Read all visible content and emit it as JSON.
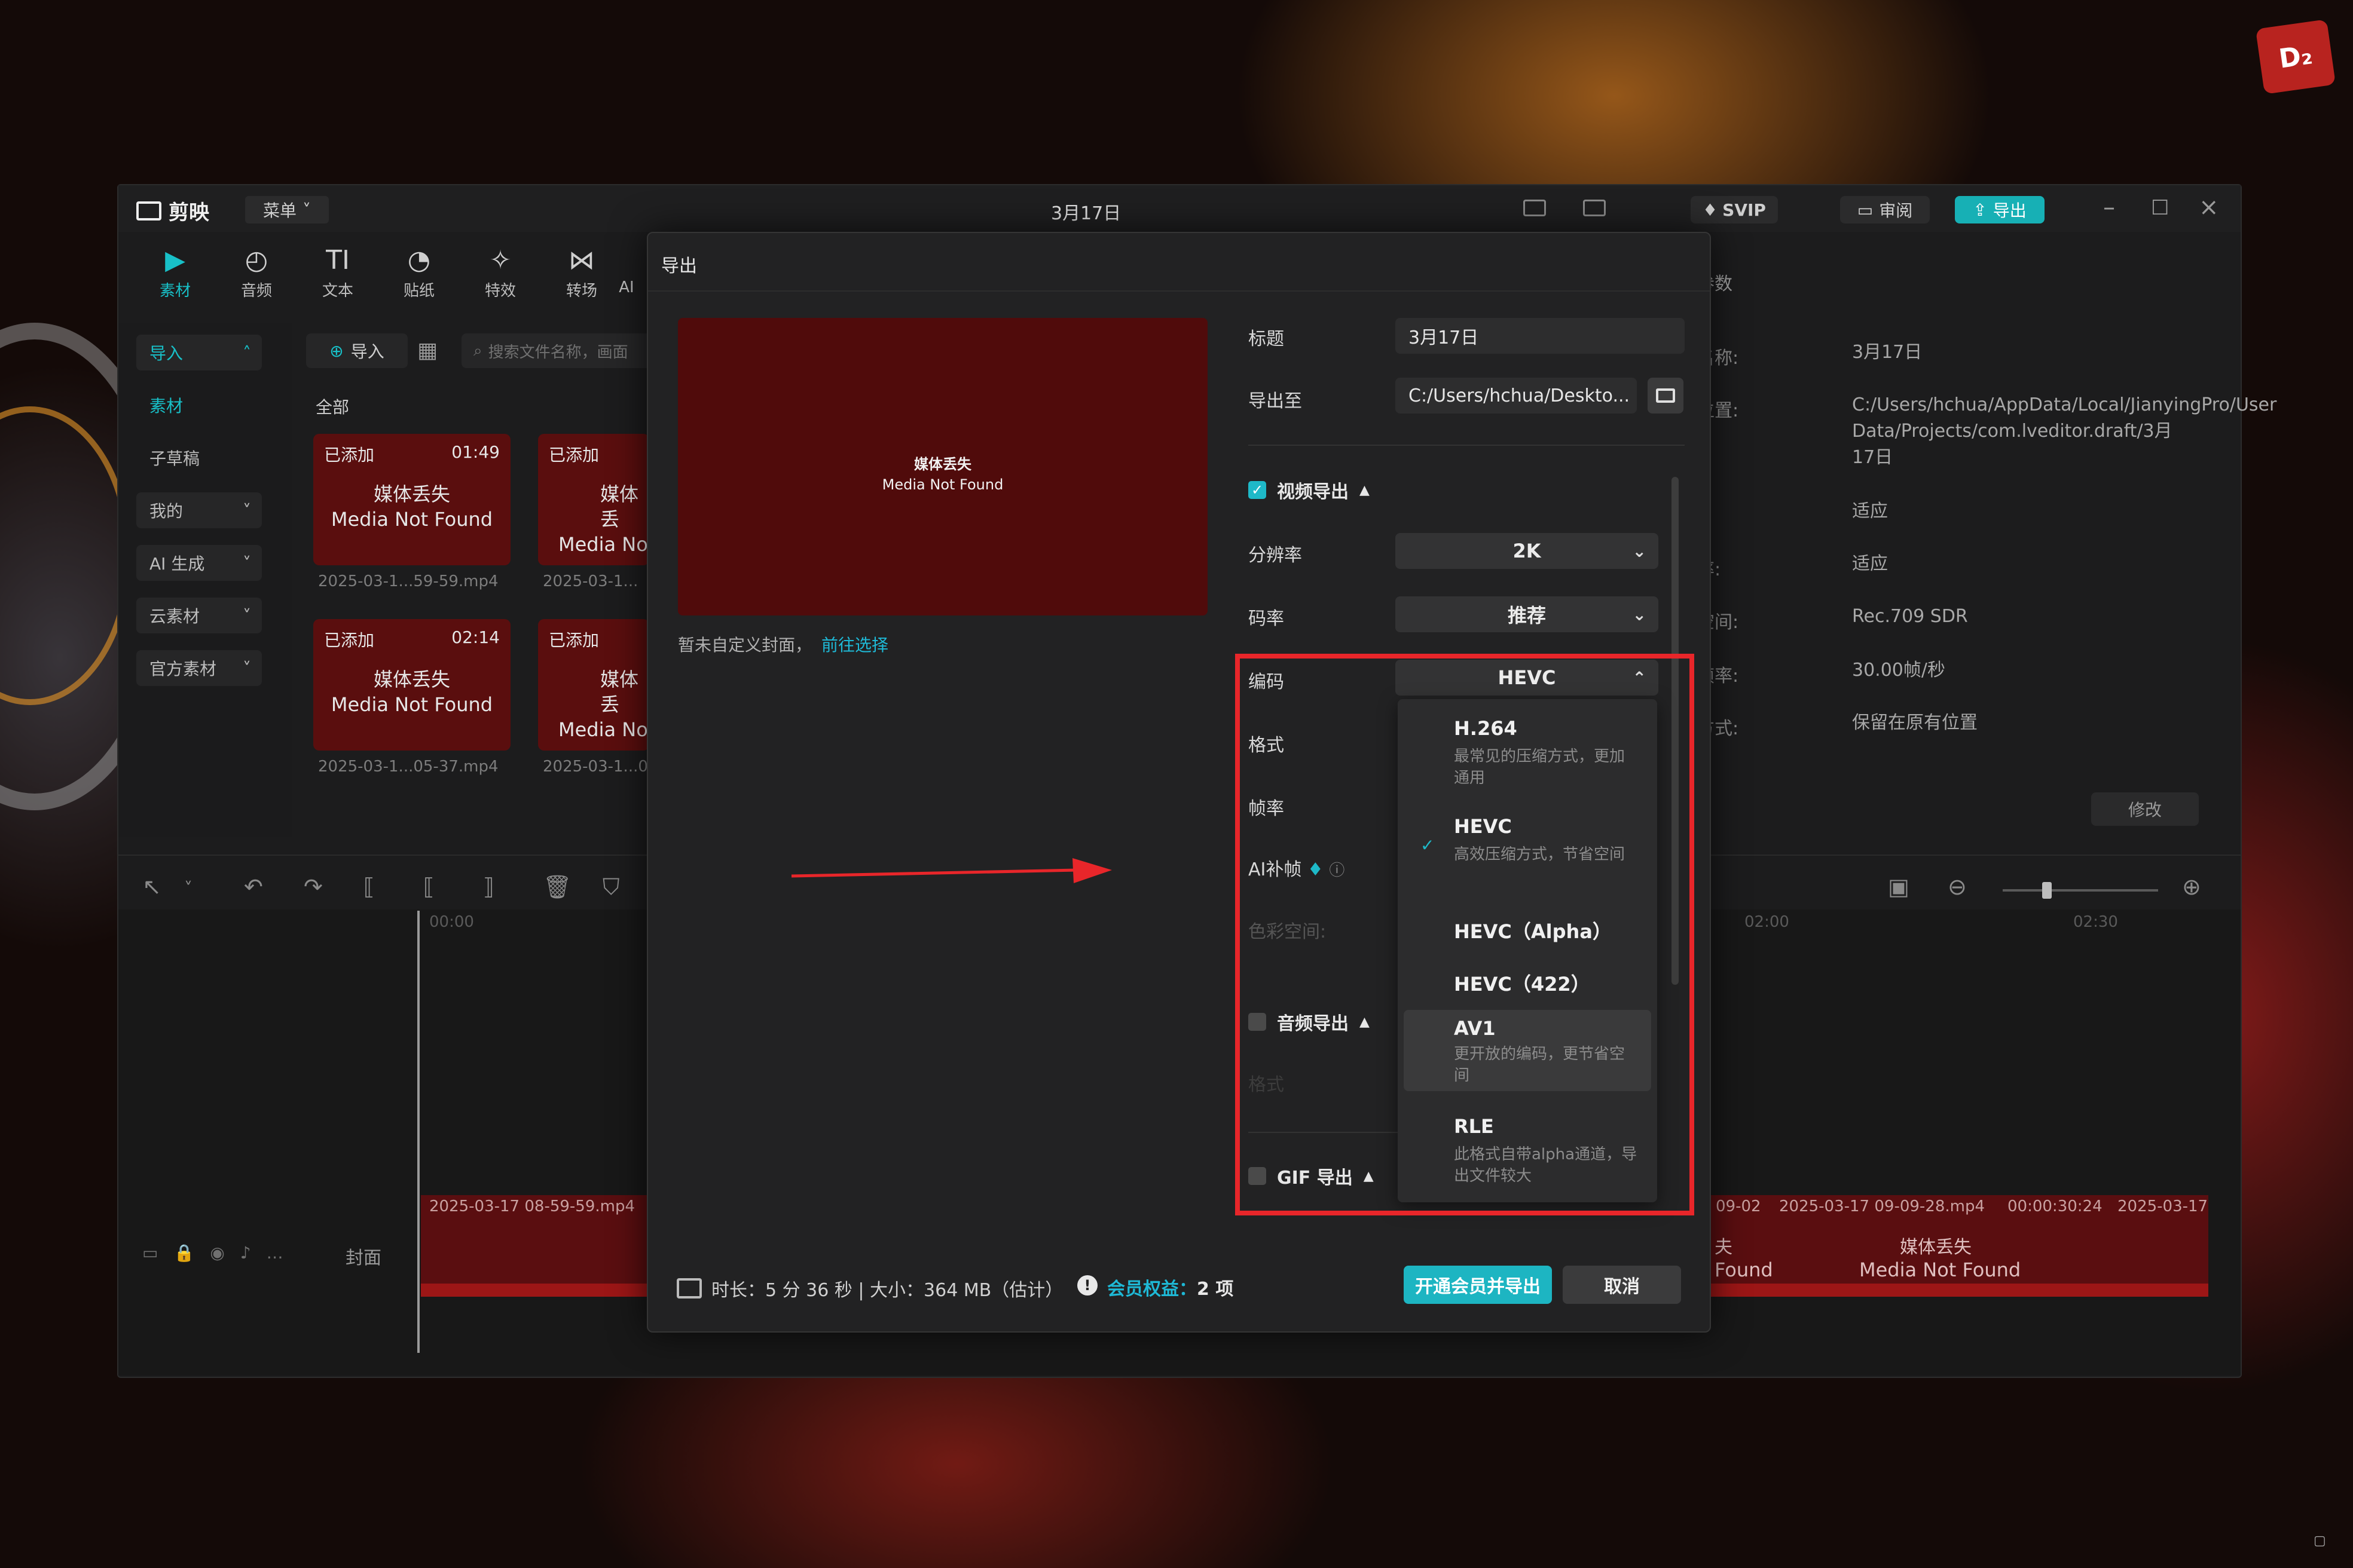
{
  "app": {
    "logo_text": "剪映",
    "menu_label": "菜单",
    "window_title": "3月17日",
    "svip_label": "SVIP",
    "review_label": "审阅",
    "export_label": "导出"
  },
  "toolbar_tabs": [
    {
      "label": "素材",
      "icon": "media-icon",
      "glyph": "▶"
    },
    {
      "label": "音频",
      "icon": "audio-icon",
      "glyph": "◴"
    },
    {
      "label": "文本",
      "icon": "text-icon",
      "glyph": "TI"
    },
    {
      "label": "贴纸",
      "icon": "sticker-icon",
      "glyph": "◔"
    },
    {
      "label": "特效",
      "icon": "effects-icon",
      "glyph": "✧"
    },
    {
      "label": "转场",
      "icon": "transition-icon",
      "glyph": "⋈"
    },
    {
      "label": "AI",
      "icon": "ai-icon",
      "glyph": ""
    }
  ],
  "left_nav": [
    {
      "label": "导入",
      "chevron": "˄"
    },
    {
      "label": "素材",
      "chevron": ""
    },
    {
      "label": "子草稿",
      "chevron": ""
    },
    {
      "label": "我的",
      "chevron": "˅"
    },
    {
      "label": "AI 生成",
      "chevron": "˅"
    },
    {
      "label": "云素材",
      "chevron": "˅"
    },
    {
      "label": "官方素材",
      "chevron": "˅"
    }
  ],
  "media": {
    "import_label": "导入",
    "search_placeholder": "搜索文件名称，画面",
    "all_label": "全部",
    "items": [
      {
        "tag": "已添加",
        "duration": "01:49",
        "line1": "媒体丢失",
        "line2": "Media Not Found",
        "file": "2025-03-1...59-59.mp4"
      },
      {
        "tag": "已添加",
        "duration": "",
        "line1": "媒体丢",
        "line2": "Media No",
        "file": "2025-03-1..."
      },
      {
        "tag": "已添加",
        "duration": "02:14",
        "line1": "媒体丢失",
        "line2": "Media Not Found",
        "file": "2025-03-1...05-37.mp4"
      },
      {
        "tag": "已添加",
        "duration": "",
        "line1": "媒体丢",
        "line2": "Media No",
        "file": "2025-03-1...0"
      }
    ]
  },
  "right_panel": {
    "header": "参数",
    "rows": [
      {
        "label": "名称:",
        "value": "3月17日"
      },
      {
        "label": "位置:",
        "value": "C:/Users/hchua/AppData/Local/JianyingPro/User Data/Projects/com.lveditor.draft/3月17日"
      },
      {
        "label": ":",
        "value": "适应"
      },
      {
        "label": "率:",
        "value": "适应"
      },
      {
        "label": "空间:",
        "value": "Rec.709 SDR"
      },
      {
        "label": "帧率:",
        "value": "30.00帧/秒"
      },
      {
        "label": "方式:",
        "value": "保留在原有位置"
      }
    ],
    "modify_label": "修改"
  },
  "timeline": {
    "time_0": "00:00",
    "time_1": "02:00",
    "time_2": "02:30",
    "cover_label": "封面",
    "clip_1": "2025-03-17 08-59-59.mp4",
    "clip_2": "09-02",
    "clip_3": "2025-03-17 09-09-28.mp4",
    "clip_3_dur": "00:00:30:24",
    "clip_4": "2025-03-17",
    "clip_text_a": "夫",
    "clip_text_b": "Found",
    "clip_text_c": "媒体丢失",
    "clip_text_d": "Media Not Found"
  },
  "dialog": {
    "title": "导出",
    "preview_line1": "媒体丢失",
    "preview_line2": "Media Not Found",
    "cover_note": "暂未自定义封面，",
    "cover_link": "前往选择",
    "title_label": "标题",
    "title_value": "3月17日",
    "export_to_label": "导出至",
    "export_to_value": "C:/Users/hchua/Deskto...",
    "video_export_label": "视频导出",
    "resolution_label": "分辨率",
    "resolution_value": "2K",
    "bitrate_label": "码率",
    "bitrate_value": "推荐",
    "codec_label": "编码",
    "codec_value": "HEVC",
    "format_label": "格式",
    "framerate_label": "帧率",
    "ai_frame_label": "AI补帧",
    "colorspace_label": "色彩空间:",
    "audio_export_label": "音频导出",
    "audio_format_label": "格式",
    "gif_export_label": "GIF 导出",
    "codec_options": [
      {
        "name": "H.264",
        "desc": "最常见的压缩方式，更加通用",
        "selected": false
      },
      {
        "name": "HEVC",
        "desc": "高效压缩方式，节省空间",
        "selected": true
      },
      {
        "name": "HEVC（Alpha）",
        "desc": "",
        "selected": false
      },
      {
        "name": "HEVC（422）",
        "desc": "",
        "selected": false
      },
      {
        "name": "AV1",
        "desc": "更开放的编码，更节省空间",
        "selected": false
      },
      {
        "name": "RLE",
        "desc": "此格式自带alpha通道，导出文件较大",
        "selected": false
      }
    ],
    "footer_info": "时长：5 分 36 秒 | 大小：364 MB（估计）",
    "benefit_label": "会员权益：",
    "benefit_count": "2 项",
    "vip_export_label": "开通会员并导出",
    "cancel_label": "取消"
  },
  "decor": {
    "badge": "D₂"
  },
  "colors": {
    "accent": "#1eb9c8",
    "highlight": "#e8262a",
    "preview_bg": "#500b0b"
  }
}
